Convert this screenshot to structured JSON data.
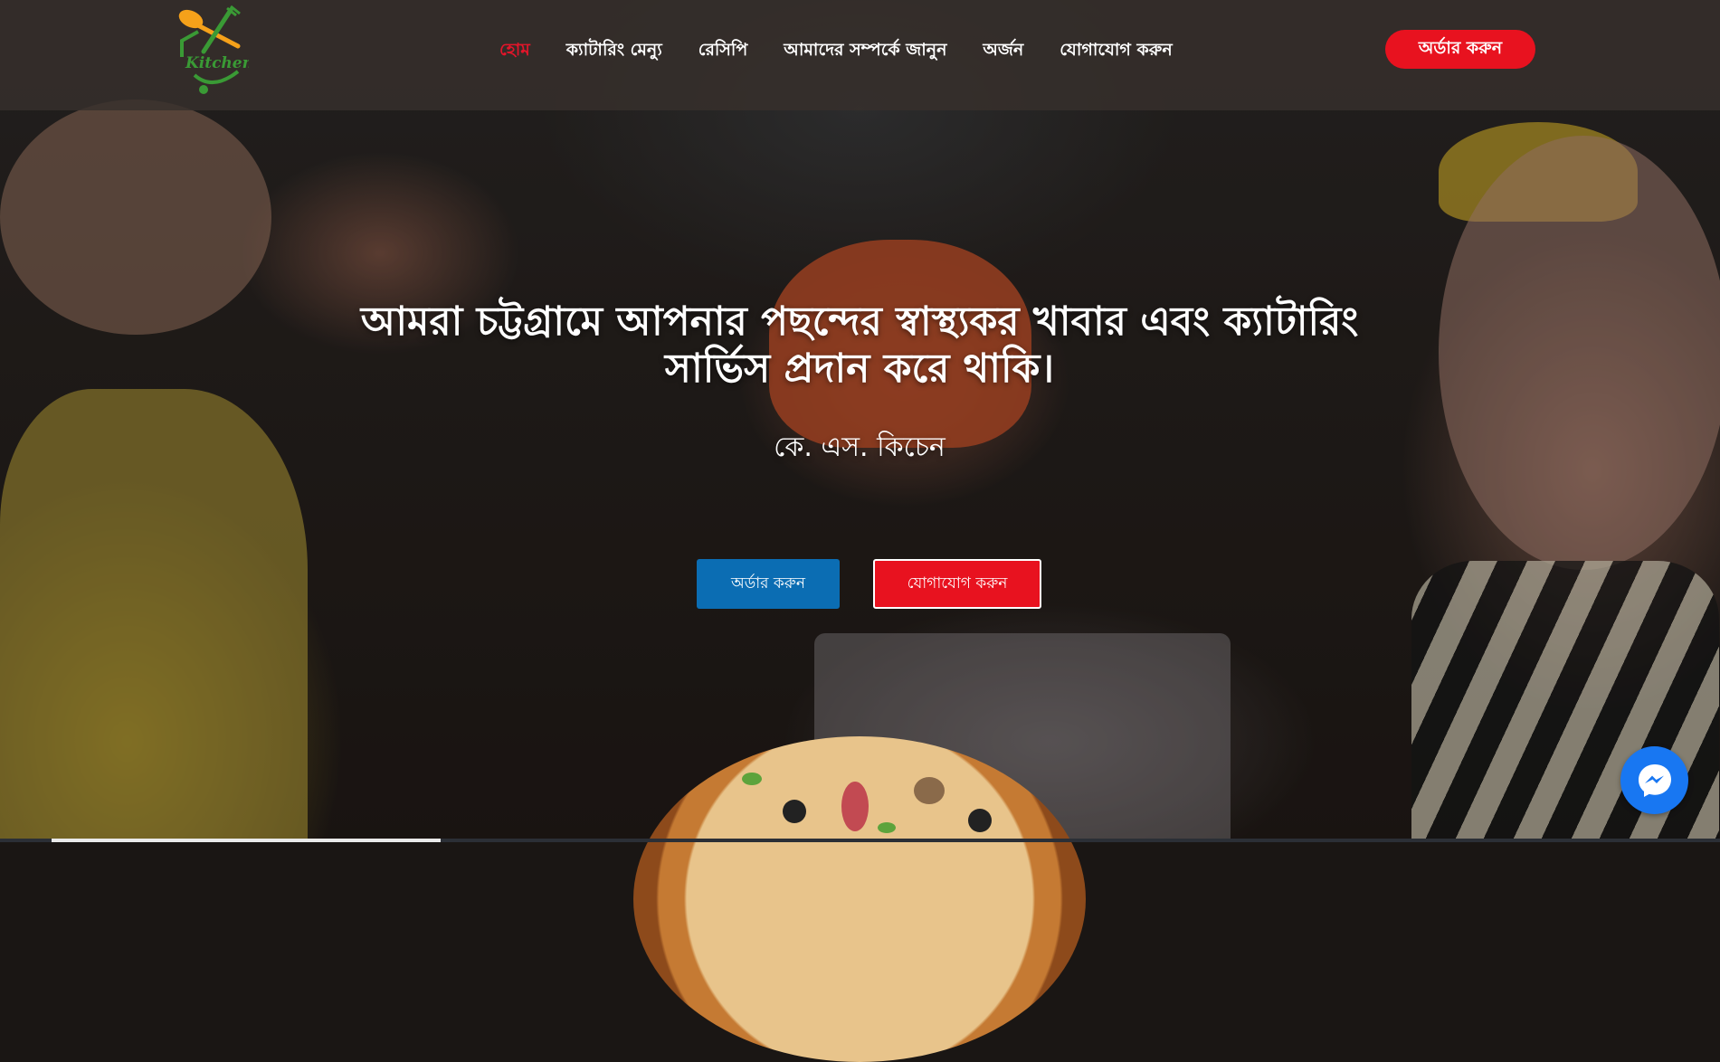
{
  "brand": {
    "logo_text": "Kitchen",
    "logo_colors": {
      "spoon": "#f5a11a",
      "fork": "#3a9a35",
      "house": "#3a9a35"
    }
  },
  "nav": {
    "items": [
      {
        "label": "হোম",
        "active": true
      },
      {
        "label": "ক্যাটারিং মেন্যু",
        "active": false
      },
      {
        "label": "রেসিপি",
        "active": false
      },
      {
        "label": "আমাদের সম্পর্কে জানুন",
        "active": false
      },
      {
        "label": "অর্জন",
        "active": false
      },
      {
        "label": "যোগাযোগ করুন",
        "active": false
      }
    ],
    "cta_label": "অর্ডার করুন"
  },
  "hero": {
    "headline_line1": "আমরা চট্টগ্রামে আপনার পছন্দের স্বাস্থ্যকর খাবার এবং ক্যাটারিং",
    "headline_line2": "সার্ভিস প্রদান করে থাকি।",
    "subtitle": "কে. এস. কিচেন",
    "primary_button": "অর্ডার করুন",
    "secondary_button": "যোগাযোগ করুন"
  },
  "colors": {
    "accent_red": "#e8121f",
    "primary_blue": "#0b6db3",
    "messenger_blue": "#1877f2"
  },
  "widgets": {
    "chat_icon": "messenger-icon"
  }
}
